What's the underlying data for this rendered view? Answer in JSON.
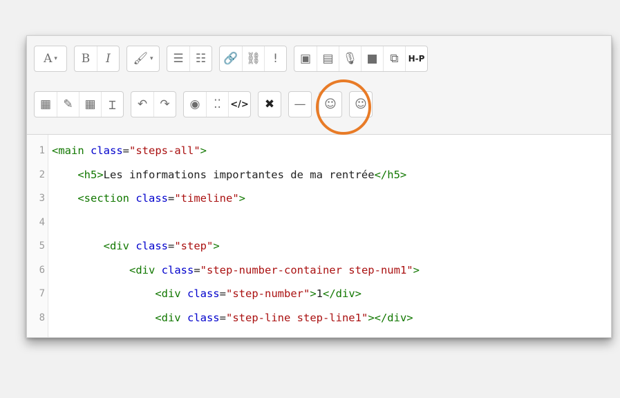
{
  "toolbar": {
    "row1": [
      [
        {
          "id": "font-size",
          "label": "A",
          "caret": "▾",
          "icon": "font-size-icon"
        }
      ],
      [
        {
          "id": "bold",
          "label": "B",
          "icon": "bold-icon"
        },
        {
          "id": "italic",
          "label": "I",
          "icon": "italic-icon"
        }
      ],
      [
        {
          "id": "brush",
          "label": "🖌",
          "caret": "▾",
          "icon": "paintbrush-icon"
        }
      ],
      [
        {
          "id": "ul",
          "label": "☰",
          "icon": "unordered-list-icon"
        },
        {
          "id": "ol",
          "label": "☷",
          "icon": "ordered-list-icon"
        }
      ],
      [
        {
          "id": "link",
          "label": "🔗",
          "icon": "link-icon"
        },
        {
          "id": "unlink",
          "label": "⛓",
          "icon": "unlink-icon"
        },
        {
          "id": "noautolink",
          "label": "!",
          "icon": "exclamation-icon"
        }
      ],
      [
        {
          "id": "image",
          "label": "▣",
          "icon": "image-icon"
        },
        {
          "id": "media",
          "label": "▤",
          "icon": "media-file-icon"
        },
        {
          "id": "audio",
          "label": "🎙",
          "icon": "microphone-icon"
        },
        {
          "id": "video",
          "label": "■",
          "icon": "video-camera-icon"
        },
        {
          "id": "copy",
          "label": "⧉",
          "icon": "copy-icon"
        },
        {
          "id": "h5p",
          "label": "H-P",
          "icon": "h5p-icon"
        }
      ]
    ],
    "row2": [
      [
        {
          "id": "calculator",
          "label": "▦",
          "icon": "calculator-icon"
        },
        {
          "id": "edit",
          "label": "✎",
          "icon": "edit-icon"
        },
        {
          "id": "table",
          "label": "▦",
          "icon": "table-icon"
        },
        {
          "id": "clear",
          "label": "Ɪ",
          "icon": "clear-formatting-icon"
        }
      ],
      [
        {
          "id": "undo",
          "label": "↶",
          "icon": "undo-icon"
        },
        {
          "id": "redo",
          "label": "↷",
          "icon": "redo-icon"
        }
      ],
      [
        {
          "id": "accessibility",
          "label": "◉",
          "icon": "accessibility-icon"
        },
        {
          "id": "screenreader",
          "label": "⁚⁚",
          "icon": "screenreader-icon"
        },
        {
          "id": "html",
          "label": "</>",
          "icon": "html-code-icon"
        }
      ],
      [
        {
          "id": "fullscreen",
          "label": "✖",
          "icon": "fullscreen-icon"
        }
      ],
      [
        {
          "id": "hr",
          "label": "—",
          "icon": "horizontal-rule-icon"
        }
      ],
      [
        {
          "id": "emoticon",
          "label": "☺",
          "icon": "emoticon-icon"
        }
      ],
      [
        {
          "id": "emoji",
          "label": "☺",
          "icon": "emoji-icon"
        }
      ]
    ]
  },
  "code": {
    "lines": [
      {
        "n": "1",
        "indent": "",
        "parts": [
          [
            "tag",
            "<main "
          ],
          [
            "attr",
            "class"
          ],
          [
            "plain",
            "="
          ],
          [
            "str",
            "\"steps-all\""
          ],
          [
            "tag",
            ">"
          ]
        ]
      },
      {
        "n": "2",
        "indent": "    ",
        "parts": [
          [
            "tag",
            "<h5>"
          ],
          [
            "plain",
            "Les informations importantes de ma rentrée"
          ],
          [
            "tag",
            "</h5>"
          ]
        ]
      },
      {
        "n": "3",
        "indent": "    ",
        "parts": [
          [
            "tag",
            "<section "
          ],
          [
            "attr",
            "class"
          ],
          [
            "plain",
            "="
          ],
          [
            "str",
            "\"timeline\""
          ],
          [
            "tag",
            ">"
          ]
        ]
      },
      {
        "n": "4",
        "indent": "",
        "parts": []
      },
      {
        "n": "5",
        "indent": "        ",
        "parts": [
          [
            "tag",
            "<div "
          ],
          [
            "attr",
            "class"
          ],
          [
            "plain",
            "="
          ],
          [
            "str",
            "\"step\""
          ],
          [
            "tag",
            ">"
          ]
        ]
      },
      {
        "n": "6",
        "indent": "            ",
        "parts": [
          [
            "tag",
            "<div "
          ],
          [
            "attr",
            "class"
          ],
          [
            "plain",
            "="
          ],
          [
            "str",
            "\"step-number-container step-num1\""
          ],
          [
            "tag",
            ">"
          ]
        ]
      },
      {
        "n": "7",
        "indent": "                ",
        "parts": [
          [
            "tag",
            "<div "
          ],
          [
            "attr",
            "class"
          ],
          [
            "plain",
            "="
          ],
          [
            "str",
            "\"step-number\""
          ],
          [
            "tag",
            ">"
          ],
          [
            "plain",
            "1"
          ],
          [
            "tag",
            "</div>"
          ]
        ]
      },
      {
        "n": "8",
        "indent": "                ",
        "parts": [
          [
            "tag",
            "<div "
          ],
          [
            "attr",
            "class"
          ],
          [
            "plain",
            "="
          ],
          [
            "str",
            "\"step-line step-line1\""
          ],
          [
            "tag",
            "></div>"
          ]
        ]
      }
    ]
  },
  "colors": {
    "highlight": "#e87b27"
  }
}
